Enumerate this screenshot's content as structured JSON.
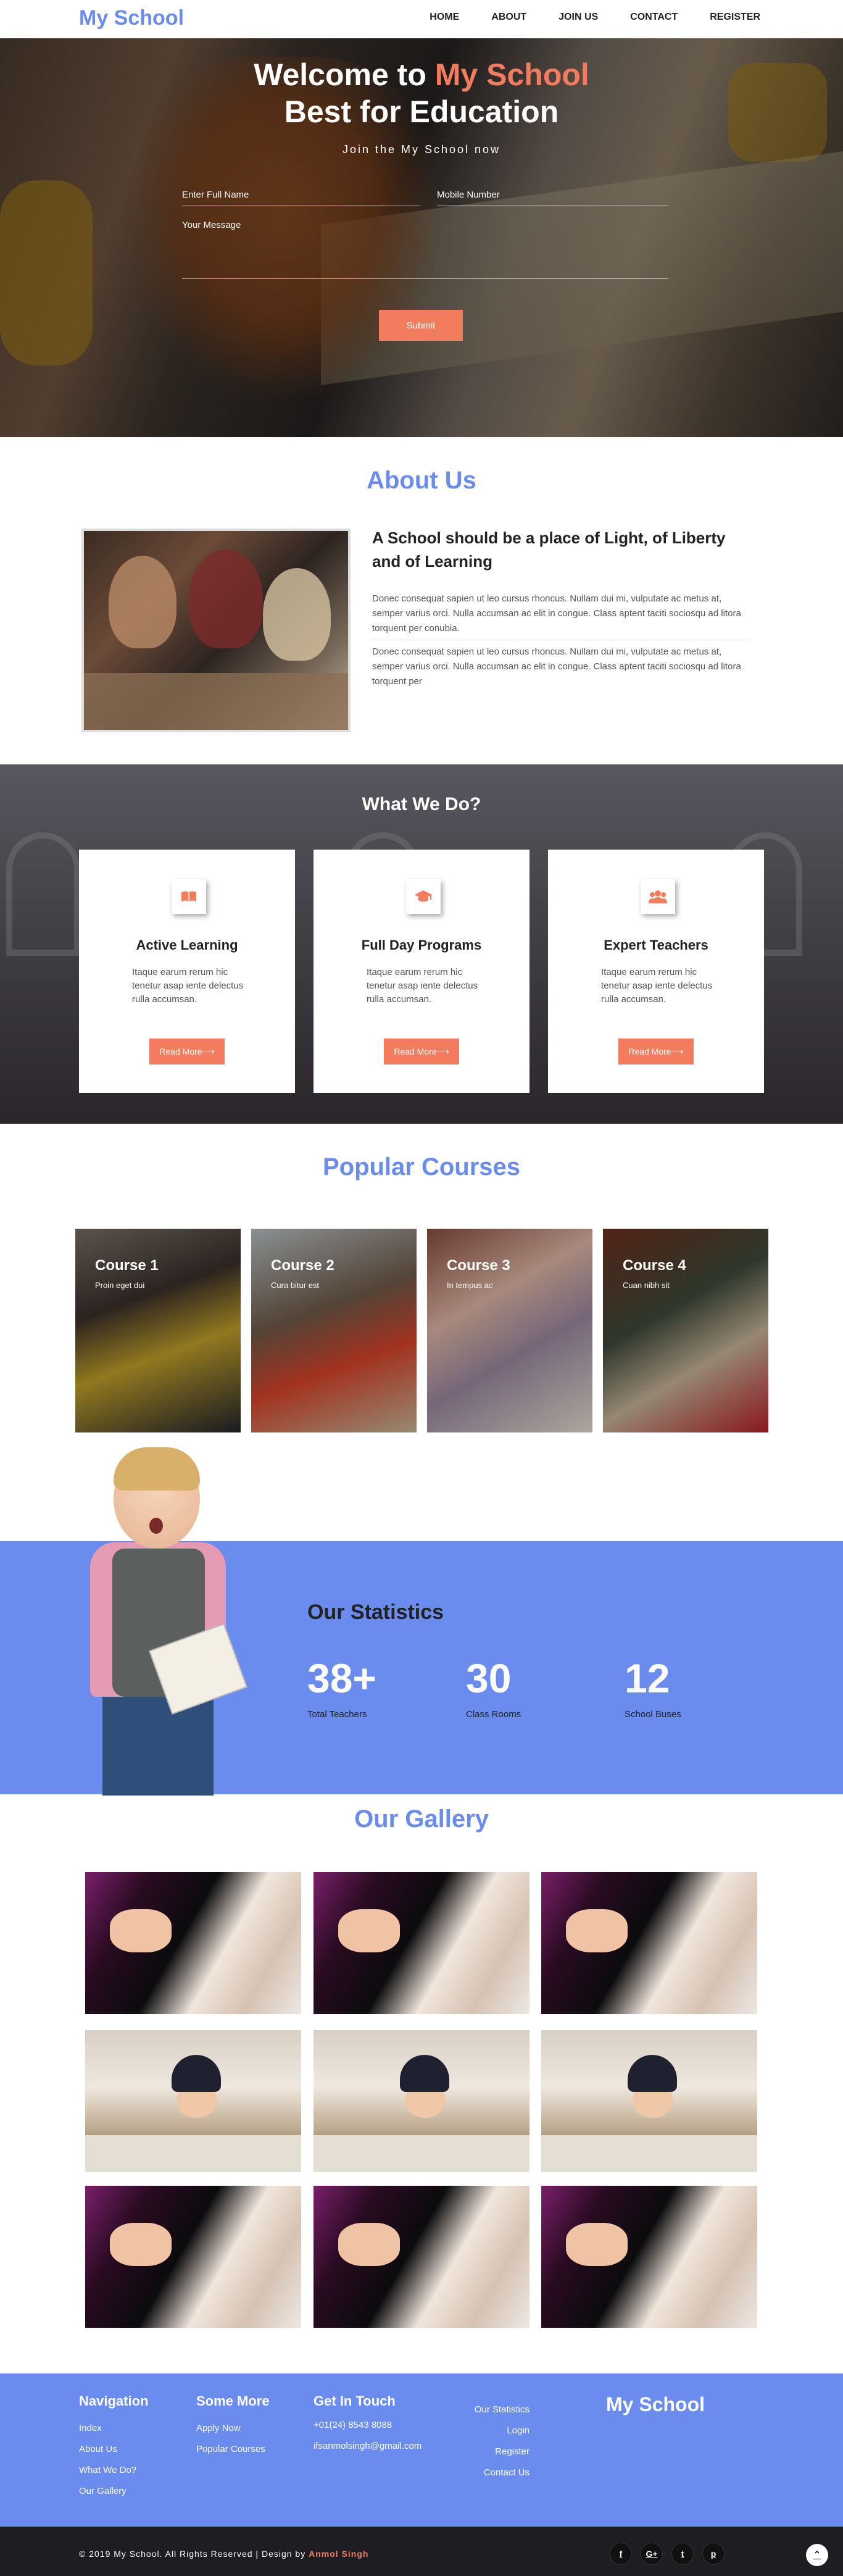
{
  "nav": {
    "brand": "My School",
    "items": [
      {
        "label": "HOME"
      },
      {
        "label": "ABOUT"
      },
      {
        "label": "JOIN US"
      },
      {
        "label": "CONTACT"
      },
      {
        "label": "REGISTER"
      }
    ]
  },
  "hero": {
    "title_pre": "Welcome to ",
    "title_accent": "My School",
    "title_line2": "Best for Education",
    "subtitle": "Join the My School now",
    "name_placeholder": "Enter Full Name",
    "mobile_placeholder": "Mobile Number",
    "message_placeholder": "Your Message",
    "submit_label": "Submit"
  },
  "about": {
    "title": "About Us",
    "heading": "A School should be a place of Light, of Liberty and of Learning",
    "para1": "Donec consequat sapien ut leo cursus rhoncus. Nullam dui mi, vulputate ac metus at, semper varius orci. Nulla accumsan ac elit in congue. Class aptent taciti sociosqu ad litora torquent per conubia.",
    "para2": "Donec consequat sapien ut leo cursus rhoncus. Nullam dui mi, vulputate ac metus at, semper varius orci. Nulla accumsan ac elit in congue. Class aptent taciti sociosqu ad litora torquent per"
  },
  "what": {
    "title": "What We Do?",
    "cards": [
      {
        "title": "Active Learning",
        "text": "Itaque earum rerum hic tenetur asap iente delectus rulla accumsan.",
        "button": "Read More⟶",
        "icon": "book-icon"
      },
      {
        "title": "Full Day Programs",
        "text": "Itaque earum rerum hic tenetur asap iente delectus rulla accumsan.",
        "button": "Read More⟶",
        "icon": "graduation-cap-icon"
      },
      {
        "title": "Expert Teachers",
        "text": "Itaque earum rerum hic tenetur asap iente delectus rulla accumsan.",
        "button": "Read More⟶",
        "icon": "users-icon"
      }
    ]
  },
  "courses": {
    "title": "Popular Courses",
    "items": [
      {
        "title": "Course 1",
        "sub": "Proin eget dui"
      },
      {
        "title": "Course 2",
        "sub": "Cura bitur est"
      },
      {
        "title": "Course 3",
        "sub": "In tempus ac"
      },
      {
        "title": "Course 4",
        "sub": "Cuan nibh sit"
      }
    ]
  },
  "stats": {
    "title": "Our Statistics",
    "items": [
      {
        "num": "38+",
        "label": "Total Teachers"
      },
      {
        "num": "30",
        "label": "Class Rooms"
      },
      {
        "num": "12",
        "label": "School Buses"
      }
    ]
  },
  "gallery": {
    "title": "Our Gallery"
  },
  "footer": {
    "nav_title": "Navigation",
    "nav_links": [
      "Index",
      "About Us",
      "What We Do?",
      "Our Gallery"
    ],
    "more_title": "Some More",
    "more_links": [
      "Apply Now",
      "Popular Courses"
    ],
    "touch_title": "Get In Touch",
    "phone": "+01(24) 8543 8088",
    "email": "ifsanmolsingh@gmail.com",
    "extra_links": [
      "Our Statistics",
      "Login",
      "Register",
      "Contact Us"
    ],
    "brand": "My School",
    "copyright": "© 2019 My School. All Rights Reserved | Design by ",
    "author": "Anmol Singh",
    "social": [
      "f",
      "G+",
      "t",
      "p"
    ],
    "to_top": "⌃"
  },
  "colors": {
    "primary_blue": "#6b8cef",
    "accent_orange": "#f47c5e",
    "dark_footer": "#1e1e22"
  }
}
